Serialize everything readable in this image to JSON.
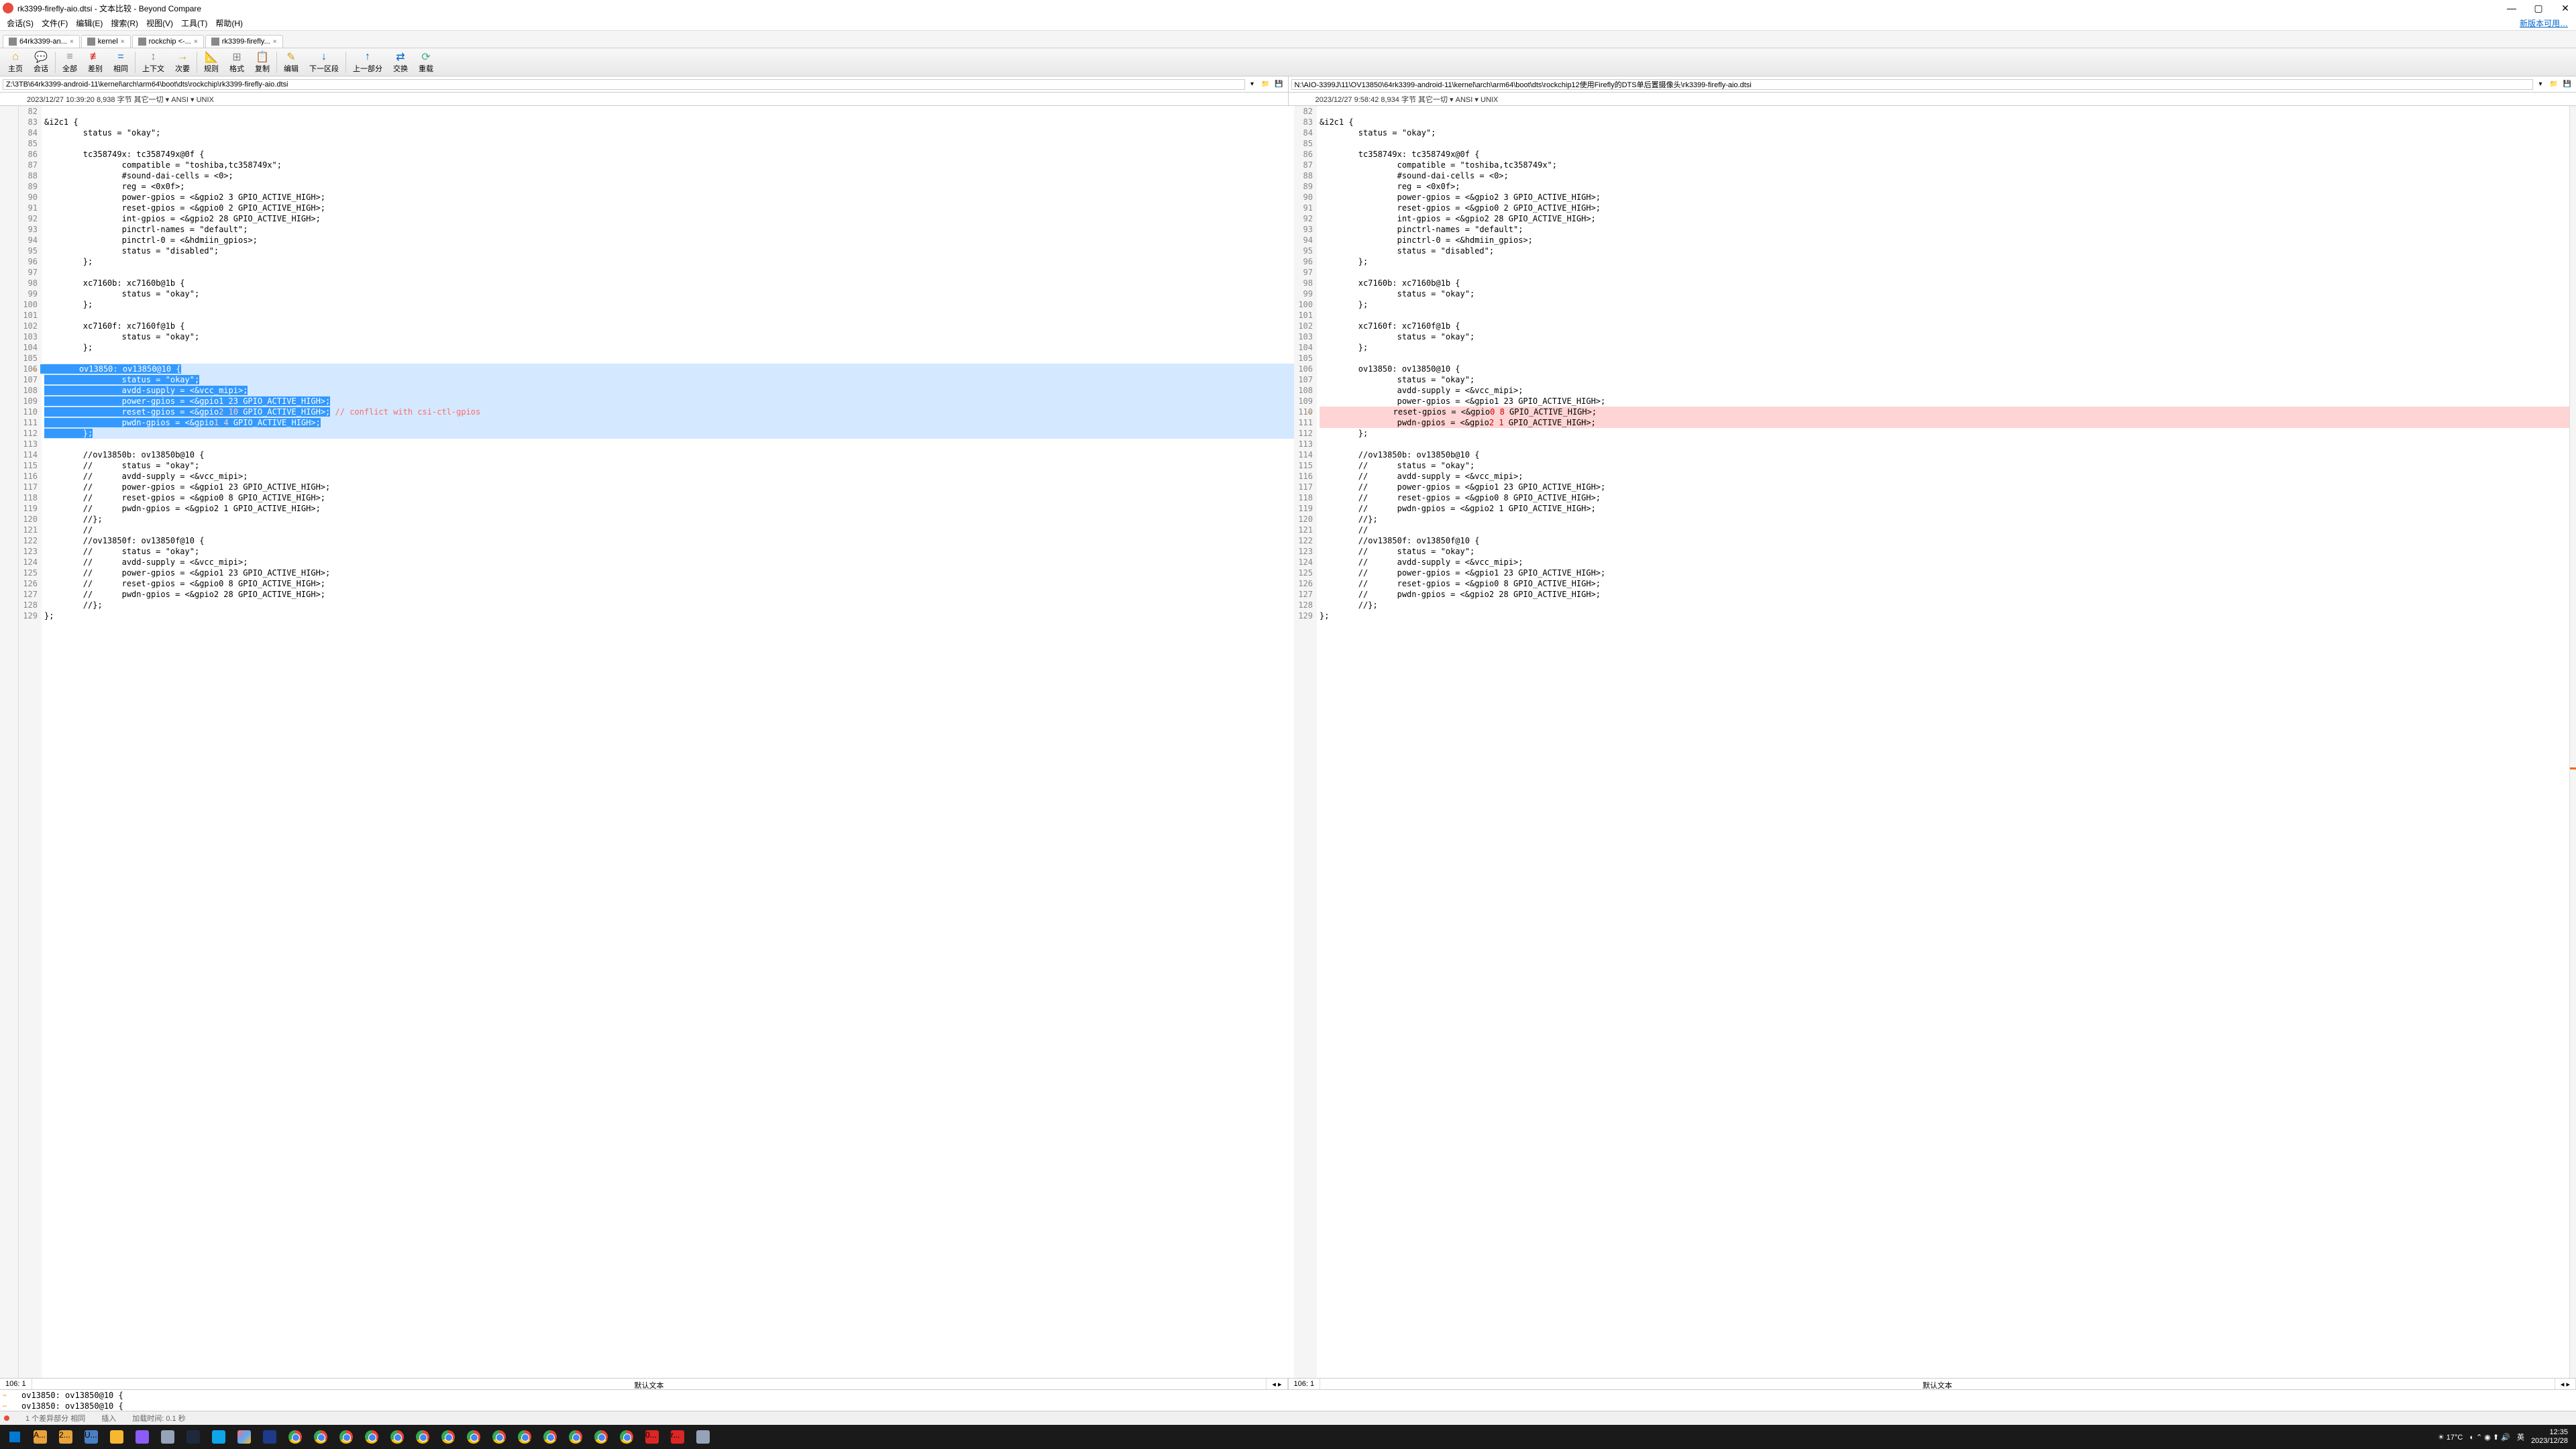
{
  "title": "rk3399-firefly-aio.dtsi - 文本比较 - Beyond Compare",
  "menus": [
    "会话(S)",
    "文件(F)",
    "编辑(E)",
    "搜索(R)",
    "视图(V)",
    "工具(T)",
    "帮助(H)"
  ],
  "update_link": "新版本可用…",
  "tabs": [
    {
      "label": "64rk3399-an...",
      "icon": "#888"
    },
    {
      "label": "kernel",
      "icon": "#888"
    },
    {
      "label": "rockchip <-...",
      "icon": "#888"
    },
    {
      "label": "rk3399-firefly...",
      "icon": "#888"
    }
  ],
  "toolbar": [
    {
      "icon": "⌂",
      "label": "主页",
      "color": "#d4a017"
    },
    {
      "icon": "💬",
      "label": "会话",
      "color": "#0066cc"
    },
    {
      "icon": "≡",
      "label": "全部",
      "color": "#888"
    },
    {
      "icon": "≢",
      "label": "差别",
      "color": "#d00"
    },
    {
      "icon": "=",
      "label": "相同",
      "color": "#0066cc"
    },
    {
      "icon": "↕",
      "label": "上下文",
      "color": "#888"
    },
    {
      "icon": "→",
      "label": "次要",
      "color": "#d4a017"
    },
    {
      "icon": "📐",
      "label": "规则",
      "color": "#888"
    },
    {
      "icon": "⊞",
      "label": "格式",
      "color": "#888"
    },
    {
      "icon": "📋",
      "label": "复制",
      "color": "#d4a017"
    },
    {
      "icon": "✎",
      "label": "编辑",
      "color": "#d4a017"
    },
    {
      "icon": "↓",
      "label": "下一区段",
      "color": "#0066cc"
    },
    {
      "icon": "↑",
      "label": "上一部分",
      "color": "#0066cc"
    },
    {
      "icon": "⇄",
      "label": "交换",
      "color": "#0066cc"
    },
    {
      "icon": "⟳",
      "label": "重载",
      "color": "#4a8"
    }
  ],
  "paths": {
    "left": "Z:\\3TB\\64rk3399-android-11\\kernel\\arch\\arm64\\boot\\dts\\rockchip\\rk3399-firefly-aio.dtsi",
    "right": "N:\\AIO-3399J\\11\\OV13850\\64rk3399-android-11\\kernel\\arch\\arm64\\boot\\dts\\rockchip12使用Firefly的DTS单后置摄像头\\rk3399-firefly-aio.dtsi"
  },
  "info": {
    "left": "2023/12/27 10:39:20  8,938 字节  其它一切 ▾ ANSI ▾ UNIX",
    "right": "2023/12/27 9:58:42  8,934 字节  其它一切 ▾ ANSI ▾ UNIX"
  },
  "code_left": [
    {
      "n": 82,
      "t": ""
    },
    {
      "n": 83,
      "t": "&i2c1 {"
    },
    {
      "n": 84,
      "t": "        status = \"okay\";"
    },
    {
      "n": 85,
      "t": ""
    },
    {
      "n": 86,
      "t": "        tc358749x: tc358749x@0f {"
    },
    {
      "n": 87,
      "t": "                compatible = \"toshiba,tc358749x\";"
    },
    {
      "n": 88,
      "t": "                #sound-dai-cells = <0>;"
    },
    {
      "n": 89,
      "t": "                reg = <0x0f>;"
    },
    {
      "n": 90,
      "t": "                power-gpios = <&gpio2 3 GPIO_ACTIVE_HIGH>;"
    },
    {
      "n": 91,
      "t": "                reset-gpios = <&gpio0 2 GPIO_ACTIVE_HIGH>;"
    },
    {
      "n": 92,
      "t": "                int-gpios = <&gpio2 28 GPIO_ACTIVE_HIGH>;"
    },
    {
      "n": 93,
      "t": "                pinctrl-names = \"default\";"
    },
    {
      "n": 94,
      "t": "                pinctrl-0 = <&hdmiin_gpios>;"
    },
    {
      "n": 95,
      "t": "                status = \"disabled\";"
    },
    {
      "n": 96,
      "t": "        };"
    },
    {
      "n": 97,
      "t": ""
    },
    {
      "n": 98,
      "t": "        xc7160b: xc7160b@1b {"
    },
    {
      "n": 99,
      "t": "                status = \"okay\";"
    },
    {
      "n": 100,
      "t": "        };"
    },
    {
      "n": 101,
      "t": ""
    },
    {
      "n": 102,
      "t": "        xc7160f: xc7160f@1b {"
    },
    {
      "n": 103,
      "t": "                status = \"okay\";"
    },
    {
      "n": 104,
      "t": "        };"
    },
    {
      "n": 105,
      "t": ""
    },
    {
      "n": 106,
      "t": "        ov13850: ov13850@10 {",
      "cls": "diff-left",
      "marker": true
    },
    {
      "n": 107,
      "t": "                status = \"okay\";",
      "cls": "diff-left"
    },
    {
      "n": 108,
      "t": "                avdd-supply = <&vcc_mipi>;",
      "cls": "diff-left"
    },
    {
      "n": 109,
      "t": "                power-gpios = <&gpio1 23 GPIO_ACTIVE_HIGH>;",
      "cls": "diff-left"
    },
    {
      "n": 110,
      "t": "                reset-gpios = <&gpio2 10 GPIO_ACTIVE_HIGH>; // conflict with csi-ctl-gpios",
      "cls": "diff-left",
      "diff110": true
    },
    {
      "n": 111,
      "t": "                pwdn-gpios = <&gpio1 4 GPIO_ACTIVE_HIGH>;",
      "cls": "diff-left",
      "diff111": true
    },
    {
      "n": 112,
      "t": "        };",
      "cls": "diff-left"
    },
    {
      "n": 113,
      "t": ""
    },
    {
      "n": 114,
      "t": "        //ov13850b: ov13850b@10 {"
    },
    {
      "n": 115,
      "t": "        //      status = \"okay\";"
    },
    {
      "n": 116,
      "t": "        //      avdd-supply = <&vcc_mipi>;"
    },
    {
      "n": 117,
      "t": "        //      power-gpios = <&gpio1 23 GPIO_ACTIVE_HIGH>;"
    },
    {
      "n": 118,
      "t": "        //      reset-gpios = <&gpio0 8 GPIO_ACTIVE_HIGH>;"
    },
    {
      "n": 119,
      "t": "        //      pwdn-gpios = <&gpio2 1 GPIO_ACTIVE_HIGH>;"
    },
    {
      "n": 120,
      "t": "        //};"
    },
    {
      "n": 121,
      "t": "        //"
    },
    {
      "n": 122,
      "t": "        //ov13850f: ov13850f@10 {"
    },
    {
      "n": 123,
      "t": "        //      status = \"okay\";"
    },
    {
      "n": 124,
      "t": "        //      avdd-supply = <&vcc_mipi>;"
    },
    {
      "n": 125,
      "t": "        //      power-gpios = <&gpio1 23 GPIO_ACTIVE_HIGH>;"
    },
    {
      "n": 126,
      "t": "        //      reset-gpios = <&gpio0 8 GPIO_ACTIVE_HIGH>;"
    },
    {
      "n": 127,
      "t": "        //      pwdn-gpios = <&gpio2 28 GPIO_ACTIVE_HIGH>;"
    },
    {
      "n": 128,
      "t": "        //};"
    },
    {
      "n": 129,
      "t": "};"
    }
  ],
  "code_right": [
    {
      "n": 82,
      "t": ""
    },
    {
      "n": 83,
      "t": "&i2c1 {"
    },
    {
      "n": 84,
      "t": "        status = \"okay\";"
    },
    {
      "n": 85,
      "t": ""
    },
    {
      "n": 86,
      "t": "        tc358749x: tc358749x@0f {"
    },
    {
      "n": 87,
      "t": "                compatible = \"toshiba,tc358749x\";"
    },
    {
      "n": 88,
      "t": "                #sound-dai-cells = <0>;"
    },
    {
      "n": 89,
      "t": "                reg = <0x0f>;"
    },
    {
      "n": 90,
      "t": "                power-gpios = <&gpio2 3 GPIO_ACTIVE_HIGH>;"
    },
    {
      "n": 91,
      "t": "                reset-gpios = <&gpio0 2 GPIO_ACTIVE_HIGH>;"
    },
    {
      "n": 92,
      "t": "                int-gpios = <&gpio2 28 GPIO_ACTIVE_HIGH>;"
    },
    {
      "n": 93,
      "t": "                pinctrl-names = \"default\";"
    },
    {
      "n": 94,
      "t": "                pinctrl-0 = <&hdmiin_gpios>;"
    },
    {
      "n": 95,
      "t": "                status = \"disabled\";"
    },
    {
      "n": 96,
      "t": "        };"
    },
    {
      "n": 97,
      "t": ""
    },
    {
      "n": 98,
      "t": "        xc7160b: xc7160b@1b {"
    },
    {
      "n": 99,
      "t": "                status = \"okay\";"
    },
    {
      "n": 100,
      "t": "        };"
    },
    {
      "n": 101,
      "t": ""
    },
    {
      "n": 102,
      "t": "        xc7160f: xc7160f@1b {"
    },
    {
      "n": 103,
      "t": "                status = \"okay\";"
    },
    {
      "n": 104,
      "t": "        };"
    },
    {
      "n": 105,
      "t": ""
    },
    {
      "n": 106,
      "t": "        ov13850: ov13850@10 {"
    },
    {
      "n": 107,
      "t": "                status = \"okay\";"
    },
    {
      "n": 108,
      "t": "                avdd-supply = <&vcc_mipi>;"
    },
    {
      "n": 109,
      "t": "                power-gpios = <&gpio1 23 GPIO_ACTIVE_HIGH>;"
    },
    {
      "n": 110,
      "t": "                reset-gpios = <&gpio0 8 GPIO_ACTIVE_HIGH>;",
      "cls": "diff-right",
      "marker": true,
      "diff110r": true
    },
    {
      "n": 111,
      "t": "                pwdn-gpios = <&gpio2 1 GPIO_ACTIVE_HIGH>;",
      "cls": "diff-right",
      "diff111r": true
    },
    {
      "n": 112,
      "t": "        };"
    },
    {
      "n": 113,
      "t": ""
    },
    {
      "n": 114,
      "t": "        //ov13850b: ov13850b@10 {"
    },
    {
      "n": 115,
      "t": "        //      status = \"okay\";"
    },
    {
      "n": 116,
      "t": "        //      avdd-supply = <&vcc_mipi>;"
    },
    {
      "n": 117,
      "t": "        //      power-gpios = <&gpio1 23 GPIO_ACTIVE_HIGH>;"
    },
    {
      "n": 118,
      "t": "        //      reset-gpios = <&gpio0 8 GPIO_ACTIVE_HIGH>;"
    },
    {
      "n": 119,
      "t": "        //      pwdn-gpios = <&gpio2 1 GPIO_ACTIVE_HIGH>;"
    },
    {
      "n": 120,
      "t": "        //};"
    },
    {
      "n": 121,
      "t": "        //"
    },
    {
      "n": 122,
      "t": "        //ov13850f: ov13850f@10 {"
    },
    {
      "n": 123,
      "t": "        //      status = \"okay\";"
    },
    {
      "n": 124,
      "t": "        //      avdd-supply = <&vcc_mipi>;"
    },
    {
      "n": 125,
      "t": "        //      power-gpios = <&gpio1 23 GPIO_ACTIVE_HIGH>;"
    },
    {
      "n": 126,
      "t": "        //      reset-gpios = <&gpio0 8 GPIO_ACTIVE_HIGH>;"
    },
    {
      "n": 127,
      "t": "        //      pwdn-gpios = <&gpio2 28 GPIO_ACTIVE_HIGH>;"
    },
    {
      "n": 128,
      "t": "        //};"
    },
    {
      "n": 129,
      "t": "};"
    }
  ],
  "status_pos": {
    "left_pos": "106: 1",
    "left_type": "默认文本",
    "right_pos": "106: 1",
    "right_type": "默认文本"
  },
  "diff_list": [
    "        ov13850: ov13850@10 {",
    "        ov13850: ov13850@10 {"
  ],
  "bottom": {
    "diff": "1 个差异部分  相同",
    "mode": "插入",
    "load": "加载时间: 0.1 秒"
  },
  "tray": {
    "weather": "17°C",
    "time": "12:35",
    "date": "2023/12/28",
    "ime": "英"
  }
}
